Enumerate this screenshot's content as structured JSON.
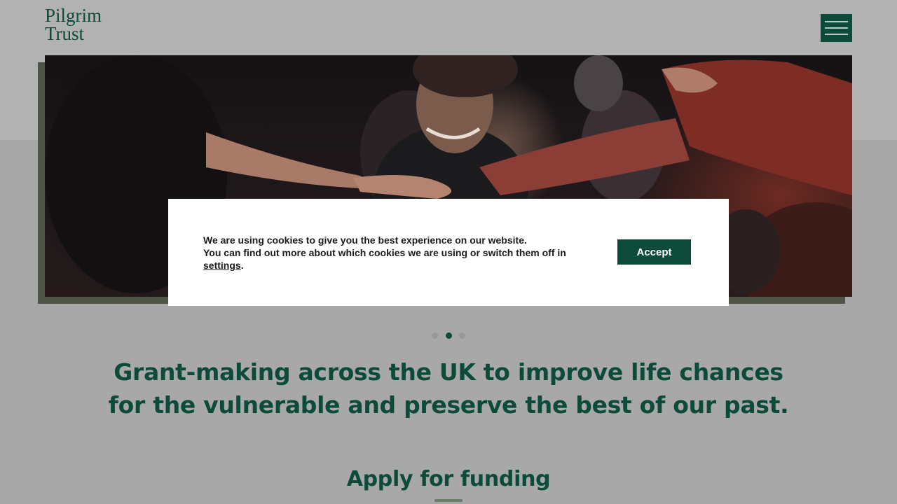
{
  "brand": {
    "logo_line1": "Pilgrim",
    "logo_line2": "Trust",
    "color": "#0c4a3a"
  },
  "header": {
    "menu_icon": "hamburger-menu-icon"
  },
  "hero": {
    "carousel_active_index": 1,
    "carousel_slide_count": 3
  },
  "cookie_banner": {
    "line1": "We are using cookies to give you the best experience on our website.",
    "line2": "You can find out more about which cookies we are using or switch them off in",
    "settings_link": "settings",
    "settings_suffix": ".",
    "accept_label": "Accept"
  },
  "main": {
    "tagline_line1": "Grant-making across the UK to improve life chances",
    "tagline_line2": "for the vulnerable and preserve the best of our past.",
    "apply_heading": "Apply for funding"
  }
}
